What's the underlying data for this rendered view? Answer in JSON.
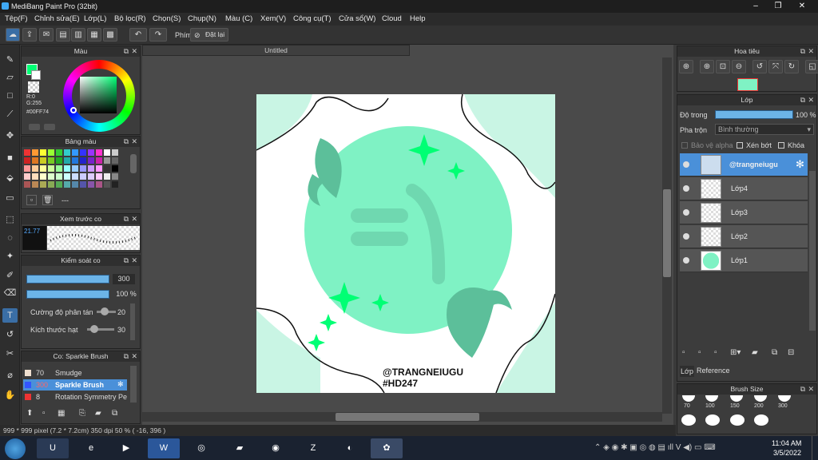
{
  "app": {
    "title": "MediBang Paint Pro (32bit)"
  },
  "menu": [
    "Tệp(F)",
    "Chỉnh sửa(E)",
    "Lớp(L)",
    "Bộ lọc(R)",
    "Chọn(S)",
    "Chụp(N)",
    "Màu (C)",
    "Xem(V)",
    "Công cụ(T)",
    "Cửa sổ(W)",
    "Cloud",
    "Help"
  ],
  "toolbar": {
    "key_label": "Phím",
    "reset_label": "Đặt lại"
  },
  "color_panel": {
    "title": "Màu",
    "r": "R:0",
    "g": "G:255",
    "hex": "#00FF74"
  },
  "palette_panel": {
    "title": "Bảng màu",
    "more": "---"
  },
  "preview_panel": {
    "title": "Xem trước co",
    "size": "21.77"
  },
  "brush_control": {
    "title": "Kiểm soát co",
    "size": "300",
    "opacity": "100 %",
    "scatter_label": "Cường độ phân tán",
    "scatter_value": "20",
    "particle_label": "Kích thước hạt",
    "particle_value": "30"
  },
  "brush_panel": {
    "title": "Co: Sparkle Brush",
    "items": [
      {
        "size": "70",
        "name": "Smudge"
      },
      {
        "size": "300",
        "name": "Sparkle Brush"
      },
      {
        "size": "8",
        "name": "Rotation Symmetry Pe"
      }
    ]
  },
  "document": {
    "tab": "Untitled",
    "watermark1": "@TRANGNEIUGU",
    "watermark2": "#HD247"
  },
  "status": {
    "text": "999 * 999 pixel   (7.2 * 7.2cm)   350 dpi   50 %   ( -16, 396 )"
  },
  "navigator": {
    "title": "Hoa tiêu"
  },
  "layer_panel": {
    "title": "Lớp",
    "opacity_label": "Độ trong",
    "opacity_value": "100 %",
    "blend_label": "Pha trộn",
    "blend_value": "Bình thường",
    "alpha_label": "Bảo vệ alpha",
    "clip_label": "Xén bớt",
    "lock_label": "Khóa",
    "layers": [
      "@trangneiugu",
      "Lớp4",
      "Lớp3",
      "Lớp2",
      "Lớp1"
    ],
    "tab_layer": "Lớp",
    "tab_reference": "Reference"
  },
  "brush_size": {
    "title": "Brush Size",
    "sizes": [
      "70",
      "100",
      "150",
      "200",
      "300"
    ]
  },
  "clock": {
    "time": "11:04 AM",
    "date": "3/5/2022"
  },
  "colors": {
    "accent": "#00FF74",
    "canvas_mint": "#7ff2c4",
    "selected_layer": "#4a90d9",
    "bar_blue": "#6cb4e8"
  }
}
